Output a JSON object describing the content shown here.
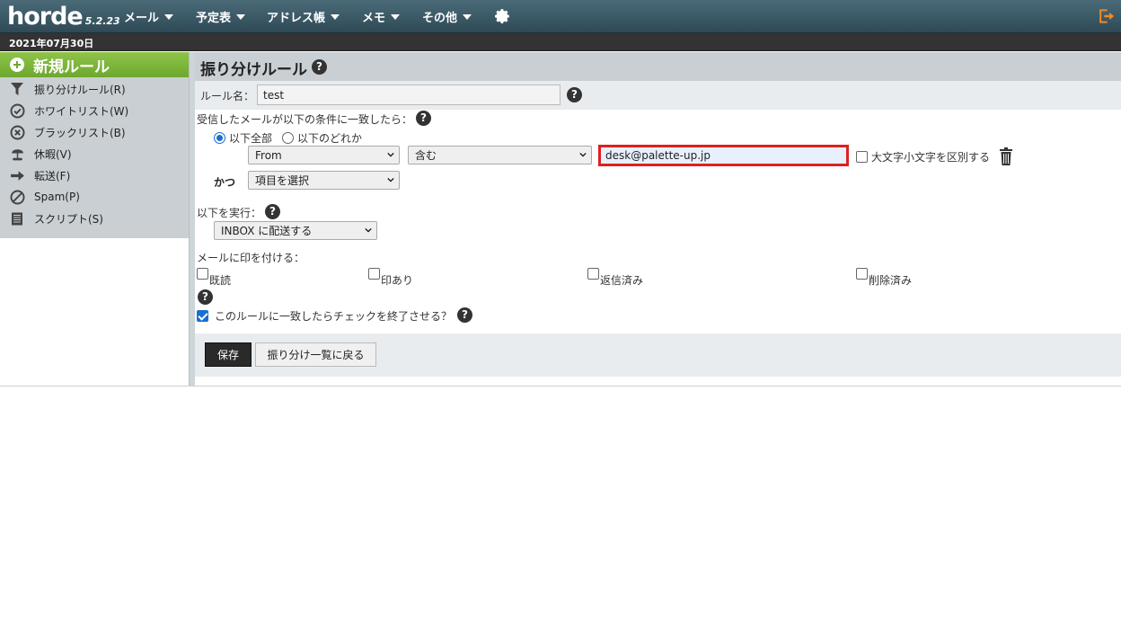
{
  "app": {
    "name": "horde",
    "version": "5.2.23"
  },
  "nav": [
    {
      "label": "メール",
      "icon": "caret-down-icon"
    },
    {
      "label": "予定表",
      "icon": "caret-down-icon"
    },
    {
      "label": "アドレス帳",
      "icon": "caret-down-icon"
    },
    {
      "label": "メモ",
      "icon": "caret-down-icon"
    },
    {
      "label": "その他",
      "icon": "caret-down-icon"
    }
  ],
  "toolbar": {
    "settings_icon": "gear-icon",
    "logout_icon": "logout-icon"
  },
  "date": "2021年07月30日",
  "sidebar": {
    "new_rule": "新規ルール",
    "items": [
      {
        "label": "振り分けルール(R)",
        "icon": "filter-icon"
      },
      {
        "label": "ホワイトリスト(W)",
        "icon": "check-circle-icon"
      },
      {
        "label": "ブラックリスト(B)",
        "icon": "x-circle-icon"
      },
      {
        "label": "休暇(V)",
        "icon": "vacation-icon"
      },
      {
        "label": "転送(F)",
        "icon": "forward-arrow-icon"
      },
      {
        "label": "Spam(P)",
        "icon": "spam-icon"
      },
      {
        "label": "スクリプト(S)",
        "icon": "script-icon"
      }
    ]
  },
  "main": {
    "title": "振り分けルール",
    "rule_name_label": "ルール名：",
    "rule_name_value": "test",
    "condition_label": "受信したメールが以下の条件に一致したら：",
    "match_all": "以下全部",
    "match_any": "以下のどれか",
    "condition": {
      "field": "From",
      "operator": "含む",
      "value": "desk@palette-up.jp",
      "case_sensitive_label": "大文字小文字を区別する"
    },
    "and_label": "かつ",
    "next_field": "項目を選択",
    "action_label": "以下を実行：",
    "action_value": "INBOX に配送する",
    "flag_label": "メールに印を付ける：",
    "flags": [
      "既読",
      "印あり",
      "返信済み",
      "削除済み"
    ],
    "stop_label": "このルールに一致したらチェックを終了させる？",
    "save_button": "保存",
    "back_button": "振り分け一覧に戻る"
  },
  "colors": {
    "accent_green": "#6ea82e",
    "highlight_red": "#e02020",
    "topbar": "#3a5966"
  }
}
